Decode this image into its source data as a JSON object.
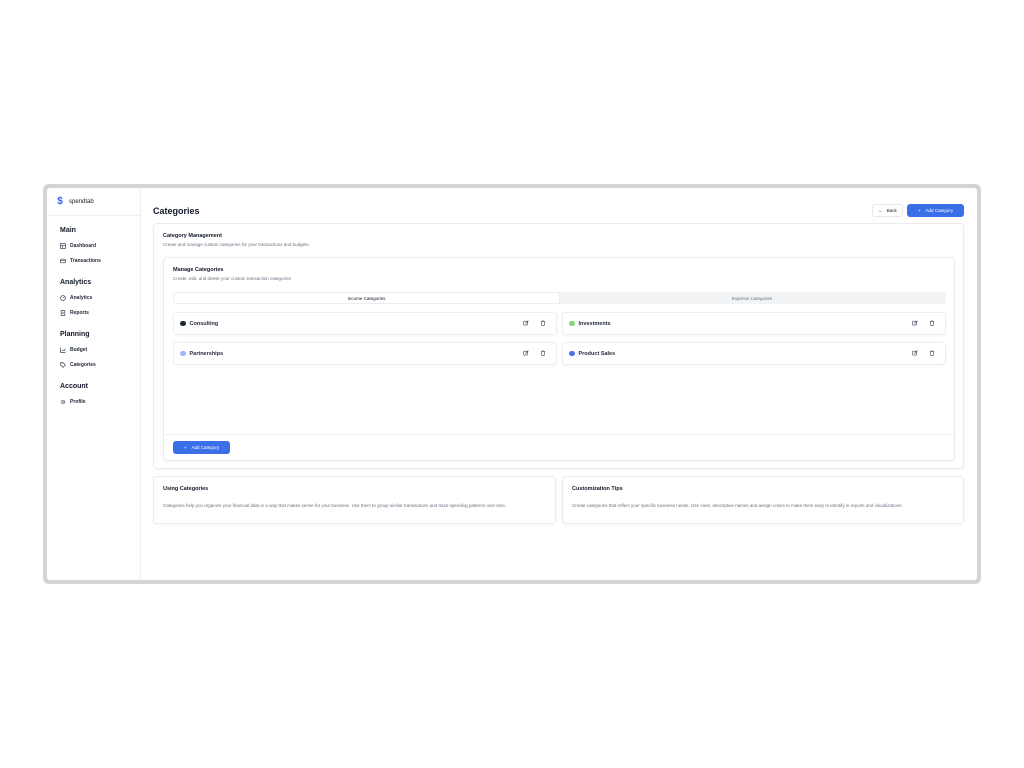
{
  "app": {
    "name": "spendtab"
  },
  "sidebar": {
    "groups": [
      {
        "title": "Main",
        "items": [
          {
            "label": "Dashboard",
            "icon": "dashboard-icon"
          },
          {
            "label": "Transactions",
            "icon": "card-icon"
          }
        ]
      },
      {
        "title": "Analytics",
        "items": [
          {
            "label": "Analytics",
            "icon": "gauge-icon"
          },
          {
            "label": "Reports",
            "icon": "document-icon"
          }
        ]
      },
      {
        "title": "Planning",
        "items": [
          {
            "label": "Budget",
            "icon": "chart-line-icon"
          },
          {
            "label": "Categories",
            "icon": "tag-icon"
          }
        ]
      },
      {
        "title": "Account",
        "items": [
          {
            "label": "Profile",
            "icon": "gear-icon"
          }
        ]
      }
    ]
  },
  "header": {
    "title": "Categories",
    "back_label": "Back",
    "add_label": "Add Category"
  },
  "management": {
    "title": "Category Management",
    "description": "Create and manage custom categories for your transactions and budgets.",
    "manage": {
      "title": "Manage Categories",
      "description": "Create, edit, and delete your custom transaction categories",
      "tabs": [
        "Income Categories",
        "Expense Categories"
      ],
      "categories": [
        {
          "name": "Consulting",
          "color": "#1f2937"
        },
        {
          "name": "Investments",
          "color": "#86d77a"
        },
        {
          "name": "Partnerships",
          "color": "#a5b4fc"
        },
        {
          "name": "Product Sales",
          "color": "#4f6ee8"
        }
      ],
      "add_label": "Add Category"
    }
  },
  "info": {
    "using": {
      "title": "Using Categories",
      "text": "Categories help you organize your financial data in a way that makes sense for your business. Use them to group similar transactions and track spending patterns over time."
    },
    "tips": {
      "title": "Customization Tips",
      "text": "Create categories that reflect your specific business needs. Use clear, descriptive names and assign colors to make them easy to identify in reports and visualizations."
    }
  }
}
